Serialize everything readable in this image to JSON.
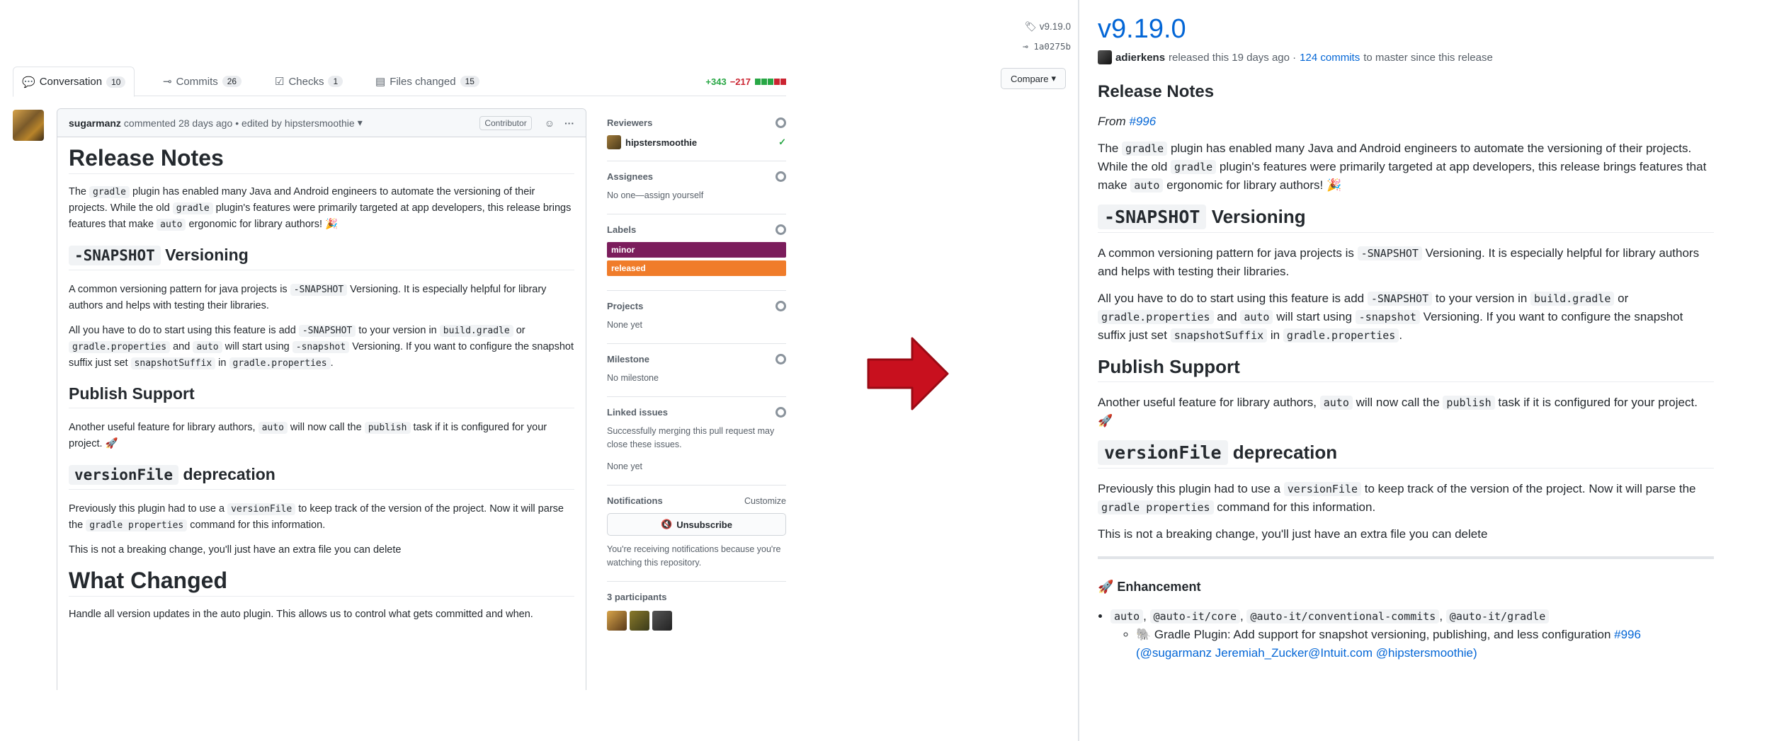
{
  "pr": {
    "tabs": [
      {
        "label": "Conversation",
        "count": "10"
      },
      {
        "label": "Commits",
        "count": "26"
      },
      {
        "label": "Checks",
        "count": "1"
      },
      {
        "label": "Files changed",
        "count": "15"
      }
    ],
    "additions": "+343",
    "deletions": "−217",
    "comment": {
      "author": "sugarmanz",
      "action": "commented 28 days ago",
      "edited_prefix": "• edited by",
      "editor": "hipstersmoothie",
      "badge": "Contributor",
      "h1": "Release Notes",
      "p1_a": "The ",
      "p1_c1": "gradle",
      "p1_b": " plugin has enabled many Java and Android engineers to automate the versioning of their projects. While the old ",
      "p1_c2": "gradle",
      "p1_d": " plugin's features were primarily targeted at app developers, this release brings features that make ",
      "p1_c3": "auto",
      "p1_e": " ergonomic for library authors! 🎉",
      "h2_1_code": "-SNAPSHOT",
      "h2_1_text": " Versioning",
      "p2_a": "A common versioning pattern for java projects is ",
      "p2_c1": "-SNAPSHOT",
      "p2_b": " Versioning. It is especially helpful for library authors and helps with testing their libraries.",
      "p3_a": "All you have to do to start using this feature is add ",
      "p3_c1": "-SNAPSHOT",
      "p3_b": " to your version in ",
      "p3_c2": "build.gradle",
      "p3_c": " or ",
      "p3_c3": "gradle.properties",
      "p3_d": " and ",
      "p3_c4": "auto",
      "p3_e": " will start using ",
      "p3_c5": "-snapshot",
      "p3_f": " Versioning. If you want to configure the snapshot suffix just set ",
      "p3_c6": "snapshotSuffix",
      "p3_g": " in ",
      "p3_c7": "gradle.properties",
      "p3_h": ".",
      "h2_2": "Publish Support",
      "p4_a": "Another useful feature for library authors, ",
      "p4_c1": "auto",
      "p4_b": " will now call the ",
      "p4_c2": "publish",
      "p4_c": " task if it is configured for your project. 🚀",
      "h2_3_code": "versionFile",
      "h2_3_text": " deprecation",
      "p5_a": "Previously this plugin had to use a ",
      "p5_c1": "versionFile",
      "p5_b": " to keep track of the version of the project. Now it will parse the ",
      "p5_c2": "gradle properties",
      "p5_c": " command for this information.",
      "p6": "This is not a breaking change, you'll just have an extra file you can delete",
      "h1_2": "What Changed",
      "p7": "Handle all version updates in the auto plugin. This allows us to control what gets committed and when."
    },
    "sidebar": {
      "reviewers_h": "Reviewers",
      "reviewer": "hipstersmoothie",
      "assignees_h": "Assignees",
      "assignees_t": "No one—assign yourself",
      "labels_h": "Labels",
      "labels": [
        {
          "name": "minor",
          "color": "#7b1d5c"
        },
        {
          "name": "released",
          "color": "#f07c2a"
        }
      ],
      "projects_h": "Projects",
      "projects_t": "None yet",
      "milestone_h": "Milestone",
      "milestone_t": "No milestone",
      "linked_h": "Linked issues",
      "linked_t": "Successfully merging this pull request may close these issues.",
      "linked_none": "None yet",
      "notif_h": "Notifications",
      "notif_customize": "Customize",
      "unsubscribe": "Unsubscribe",
      "notif_t": "You're receiving notifications because you're watching this repository.",
      "participants": "3 participants"
    }
  },
  "release": {
    "tag": "v9.19.0",
    "commit": "1a0275b",
    "compare": "Compare",
    "title": "v9.19.0",
    "author": "adierkens",
    "meta_a": "released this 19 days ago ·",
    "commits_link": "124 commits",
    "meta_b": "to master since this release",
    "h2": "Release Notes",
    "from_prefix": "From ",
    "from_link": "#996",
    "p1_a": "The ",
    "p1_c1": "gradle",
    "p1_b": " plugin has enabled many Java and Android engineers to automate the versioning of their projects. While the old ",
    "p1_c2": "gradle",
    "p1_d": " plugin's features were primarily targeted at app developers, this release brings features that make ",
    "p1_c3": "auto",
    "p1_e": " ergonomic for library authors! 🎉",
    "h3_1_code": "-SNAPSHOT",
    "h3_1_text": " Versioning",
    "p2_a": "A common versioning pattern for java projects is ",
    "p2_c1": "-SNAPSHOT",
    "p2_b": " Versioning. It is especially helpful for library authors and helps with testing their libraries.",
    "p3_a": "All you have to do to start using this feature is add ",
    "p3_c1": "-SNAPSHOT",
    "p3_b": " to your version in ",
    "p3_c2": "build.gradle",
    "p3_c": " or ",
    "p3_c3": "gradle.properties",
    "p3_d": " and ",
    "p3_c4": "auto",
    "p3_e": " will start using ",
    "p3_c5": "-snapshot",
    "p3_f": " Versioning. If you want to configure the snapshot suffix just set ",
    "p3_c6": "snapshotSuffix",
    "p3_g": " in ",
    "p3_c7": "gradle.properties",
    "p3_h": ".",
    "h3_2": "Publish Support",
    "p4_a": "Another useful feature for library authors, ",
    "p4_c1": "auto",
    "p4_b": " will now call the ",
    "p4_c2": "publish",
    "p4_c": " task if it is configured for your project. 🚀",
    "h3_3_code": "versionFile",
    "h3_3_text": " deprecation",
    "p5_a": "Previously this plugin had to use a ",
    "p5_c1": "versionFile",
    "p5_b": " to keep track of the version of the project. Now it will parse the ",
    "p5_c2": "gradle properties",
    "p5_c": " command for this information.",
    "p6": "This is not a breaking change, you'll just have an extra file you can delete",
    "enhancement": "🚀 Enhancement",
    "packages": [
      "auto",
      ", ",
      "@auto-it/core",
      ", ",
      "@auto-it/conventional-commits",
      ", ",
      "@auto-it/gradle"
    ],
    "item_text": "🐘 Gradle Plugin: Add support for snapshot versioning, publishing, and less configuration ",
    "item_link": "#996",
    "item_authors": "@sugarmanz Jeremiah_Zucker@Intuit.com @hipstersmoothie"
  },
  "colors": {
    "link": "#0366d6",
    "arrow": "#c8101e",
    "add": "#28a745",
    "del": "#cb2431"
  }
}
